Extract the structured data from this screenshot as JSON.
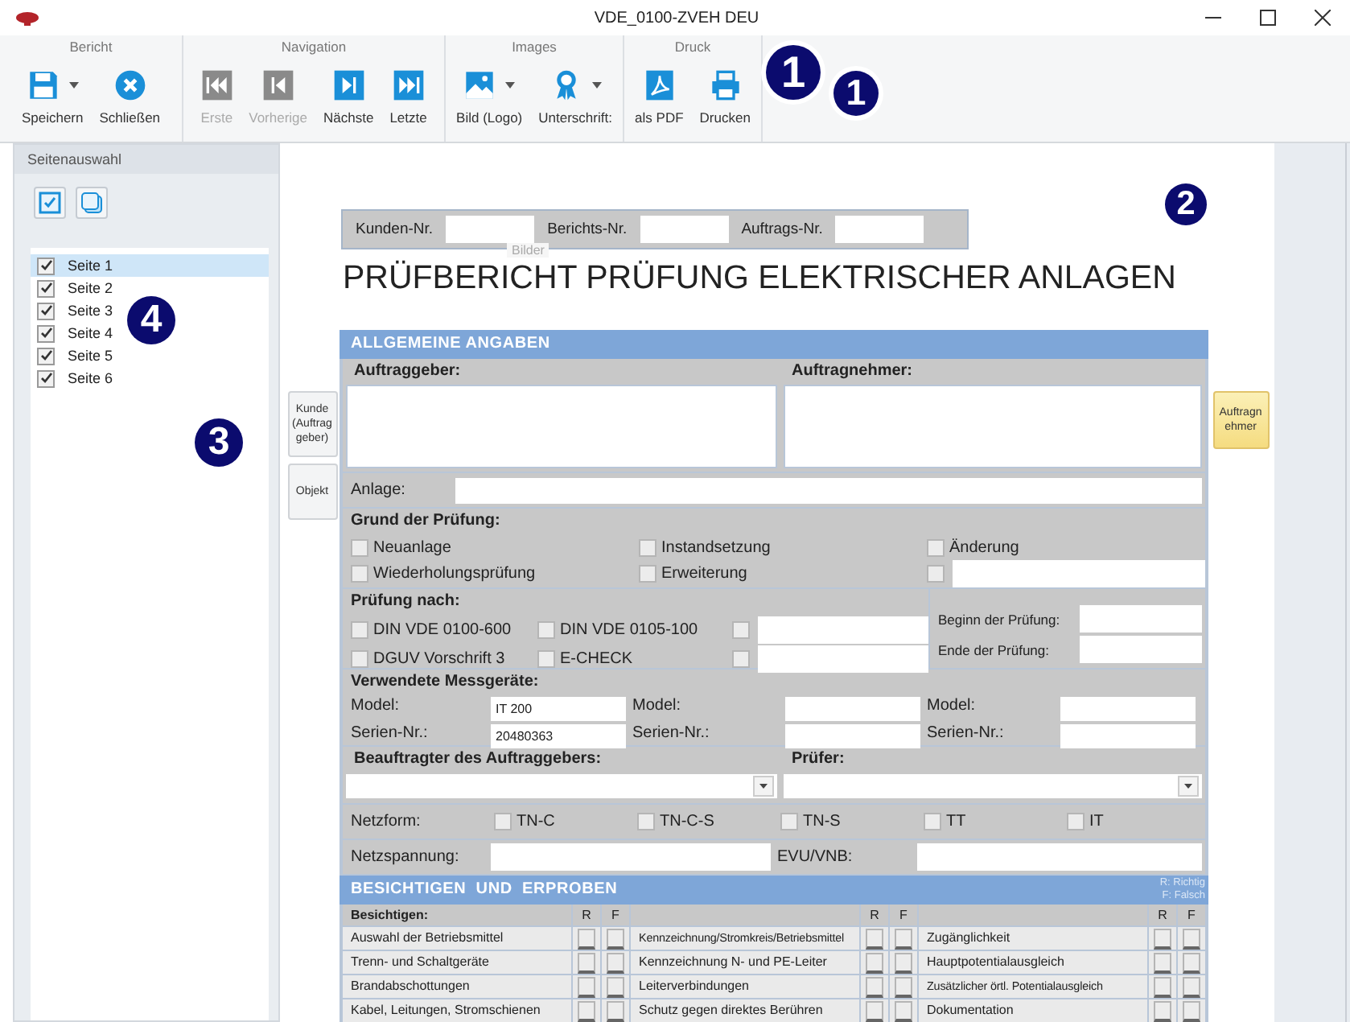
{
  "window": {
    "title": "VDE_0100-ZVEH DEU"
  },
  "ribbon": {
    "groups": [
      {
        "label": "Bericht",
        "buttons": [
          {
            "label": "Speichern",
            "kind": "save",
            "dropdown": true,
            "disabled": false
          },
          {
            "label": "Schließen",
            "kind": "close",
            "dropdown": false,
            "disabled": false
          }
        ]
      },
      {
        "label": "Navigation",
        "buttons": [
          {
            "label": "Erste",
            "kind": "first",
            "dropdown": false,
            "disabled": true
          },
          {
            "label": "Vorherige",
            "kind": "prev",
            "dropdown": false,
            "disabled": true
          },
          {
            "label": "Nächste",
            "kind": "next",
            "dropdown": false,
            "disabled": false
          },
          {
            "label": "Letzte",
            "kind": "last",
            "dropdown": false,
            "disabled": false
          }
        ]
      },
      {
        "label": "Images",
        "buttons": [
          {
            "label": "Bild (Logo)",
            "kind": "image",
            "dropdown": true,
            "disabled": false
          },
          {
            "label": "Unterschrift:",
            "kind": "seal",
            "dropdown": true,
            "disabled": false
          }
        ]
      },
      {
        "label": "Druck",
        "buttons": [
          {
            "label": "als PDF",
            "kind": "pdf",
            "dropdown": false,
            "disabled": false
          },
          {
            "label": "Drucken",
            "kind": "print",
            "dropdown": false,
            "disabled": false
          }
        ]
      }
    ],
    "callouts": [
      "1",
      "1"
    ]
  },
  "sidebar": {
    "title": "Seitenauswahl",
    "callouts": [
      "4",
      "3"
    ],
    "pages": [
      {
        "label": "Seite 1",
        "checked": true,
        "selected": true
      },
      {
        "label": "Seite 2",
        "checked": true,
        "selected": false
      },
      {
        "label": "Seite 3",
        "checked": true,
        "selected": false
      },
      {
        "label": "Seite 4",
        "checked": true,
        "selected": false
      },
      {
        "label": "Seite 5",
        "checked": true,
        "selected": false
      },
      {
        "label": "Seite 6",
        "checked": true,
        "selected": false
      }
    ]
  },
  "page": {
    "callout": "2",
    "side_tabs_left": [
      {
        "label": "Kunde (Auftrag geber)",
        "selected": false
      },
      {
        "label": "Objekt",
        "selected": false
      }
    ],
    "side_tabs_right": [
      {
        "label": "Auftragn ehmer",
        "selected": true
      }
    ],
    "header_fields": [
      {
        "label": "Kunden-Nr."
      },
      {
        "label": "Berichts-Nr."
      },
      {
        "label": "Auftrags-Nr."
      }
    ],
    "images_label": "Bilder",
    "title": "PRÜFBERICHT PRÜFUNG ELEKTRISCHER ANLAGEN",
    "section_1": "ALLGEMEINE ANGABEN",
    "parties": [
      "Auftraggeber:",
      "Auftragnehmer:"
    ],
    "anlage": "Anlage:",
    "grund": {
      "title": "Grund der Prüfung:",
      "options": [
        {
          "label": "Neuanlage",
          "checked": false
        },
        {
          "label": "Instandsetzung",
          "checked": false
        },
        {
          "label": "Änderung",
          "checked": false
        },
        {
          "label": "Wiederholungsprüfung",
          "checked": false
        },
        {
          "label": "Erweiterung",
          "checked": false
        },
        {
          "kind": "other",
          "checked": false
        }
      ]
    },
    "pruefung": {
      "title": "Prüfung nach:",
      "options": [
        {
          "label": "DIN VDE 0100-600",
          "checked": false
        },
        {
          "label": "DIN VDE 0105-100",
          "checked": false
        },
        {
          "kind": "other",
          "checked": false
        },
        {
          "label": "DGUV Vorschrift 3",
          "checked": false
        },
        {
          "label": "E-CHECK",
          "checked": false
        },
        {
          "kind": "other",
          "checked": false
        }
      ],
      "dates": [
        "Beginn der Prüfung:",
        "Ende der Prüfung:"
      ]
    },
    "messgeraete": {
      "title": "Verwendete Messgeräte:",
      "devices": [
        {
          "model_label": "Model:",
          "model": "IT 200",
          "serial_label": "Serien-Nr.:",
          "serial": "20480363"
        },
        {
          "model_label": "Model:",
          "serial_label": "Serien-Nr.:"
        },
        {
          "model_label": "Model:",
          "serial_label": "Serien-Nr.:"
        }
      ]
    },
    "persons": [
      "Beauftragter des Auftraggebers:",
      "Prüfer:"
    ],
    "netzform": {
      "label": "Netzform:",
      "options": [
        {
          "label": "TN-C",
          "checked": false
        },
        {
          "label": "TN-C-S",
          "checked": false
        },
        {
          "label": "TN-S",
          "checked": false
        },
        {
          "label": "TT",
          "checked": false
        },
        {
          "label": "IT",
          "checked": false
        }
      ]
    },
    "netzspannung": "Netzspannung:",
    "evu": "EVU/VNB:",
    "section_2": "BESICHTIGEN  UND  ERPROBEN",
    "legend": [
      "R: Richtig",
      "F: Falsch"
    ],
    "table": {
      "column_groups": [
        {
          "label": "Besichtigen:",
          "r": "R",
          "f": "F"
        },
        {
          "r": "R",
          "f": "F"
        },
        {
          "r": "R",
          "f": "F"
        }
      ],
      "rows": [
        [
          {
            "label": "Auswahl der Betriebsmittel",
            "r": false,
            "f": false
          },
          {
            "label": "Kennzeichnung/Stromkreis/Betriebsmittel",
            "r": false,
            "f": false
          },
          {
            "label": "Zugänglichkeit",
            "r": false,
            "f": false
          }
        ],
        [
          {
            "label": "Trenn- und Schaltgeräte",
            "r": false,
            "f": false
          },
          {
            "label": "Kennzeichnung N- und PE-Leiter",
            "r": false,
            "f": false
          },
          {
            "label": "Hauptpotentialausgleich",
            "r": false,
            "f": false
          }
        ],
        [
          {
            "label": "Brandabschottungen",
            "r": false,
            "f": false
          },
          {
            "label": "Leiterverbindungen",
            "r": false,
            "f": false
          },
          {
            "label": "Zusätzlicher örtl. Potentialausgleich",
            "r": false,
            "f": false
          }
        ],
        [
          {
            "label": "Kabel, Leitungen, Stromschienen",
            "r": false,
            "f": false
          },
          {
            "label": "Schutz gegen direktes Berühren",
            "r": false,
            "f": false
          },
          {
            "label": "Dokumentation",
            "r": false,
            "f": false
          }
        ]
      ]
    }
  }
}
